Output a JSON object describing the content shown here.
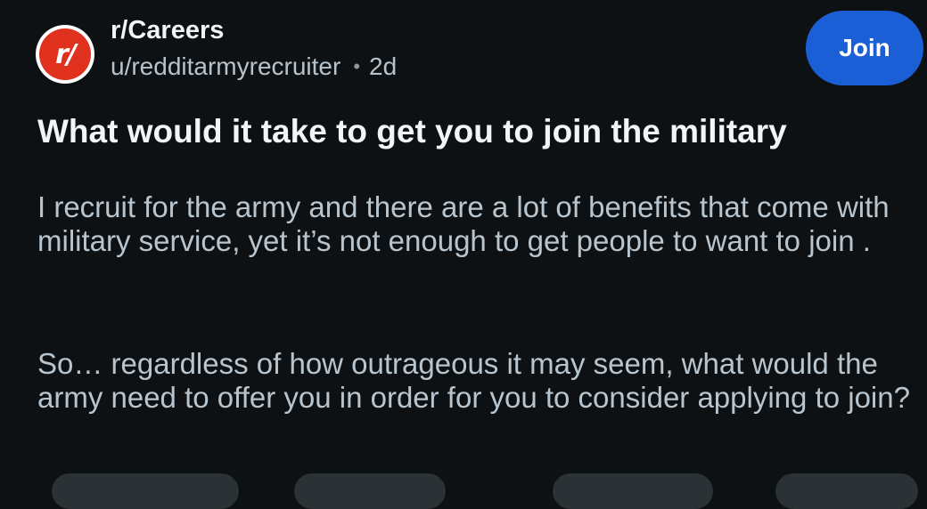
{
  "post": {
    "subreddit": "r/Careers",
    "avatar_label": "r/",
    "author": "u/redditarmyrecruiter",
    "separator": "•",
    "age": "2d",
    "join_label": "Join",
    "title": "What would it take to get you to join the military",
    "body": [
      "I recruit for the army and there are a lot of benefits that come with military service, yet it’s not enough to get people to want to join .",
      "So… regardless of how outrageous it may seem, what would the army need to offer you in order for you to consider applying to join?"
    ]
  },
  "colors": {
    "background": "#0e1113",
    "join_button": "#1b5fd6",
    "avatar_red": "#e0301e",
    "body_text": "#b8c5cf"
  }
}
